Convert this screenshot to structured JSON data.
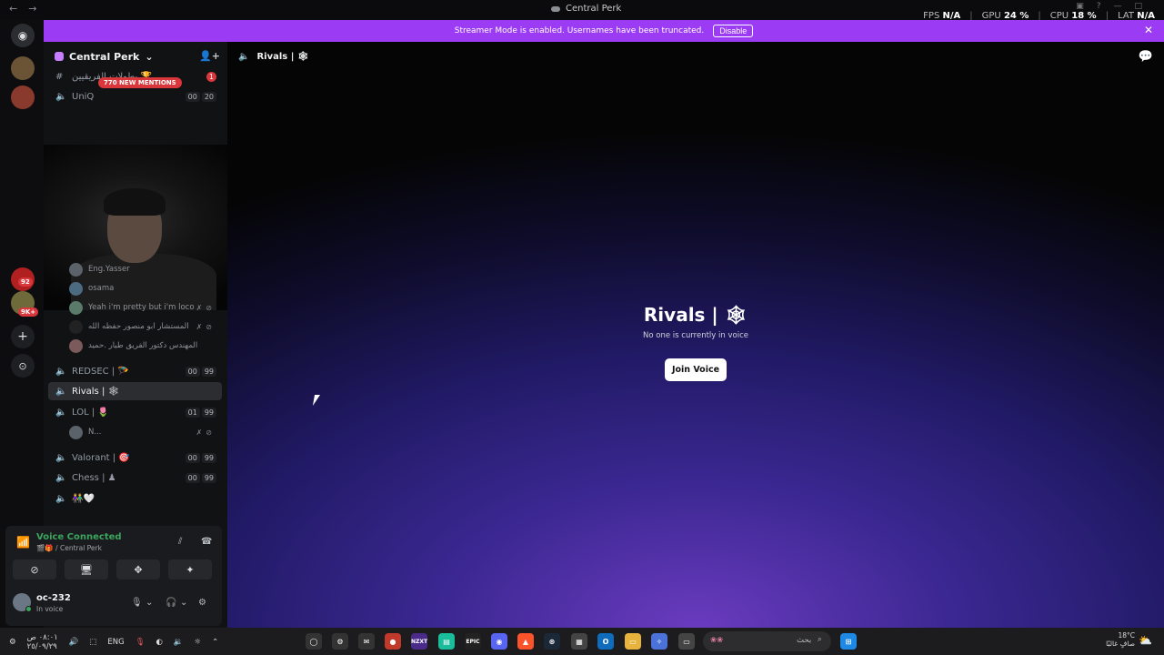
{
  "titlebar": {
    "title": "Central Perk"
  },
  "stats": {
    "fps_label": "FPS",
    "fps_value": "N/A",
    "gpu_label": "GPU",
    "gpu_value": "24 %",
    "cpu_label": "CPU",
    "cpu_value": "18 %",
    "lat_label": "LAT",
    "lat_value": "N/A"
  },
  "banner": {
    "text": "Streamer Mode is enabled. Usernames have been truncated.",
    "disable_label": "Disable"
  },
  "rail": {
    "badges": [
      "92",
      "9K+"
    ]
  },
  "server": {
    "name": "Central Perk"
  },
  "mentions_label": "770 NEW MENTIONS",
  "channels": [
    {
      "name": "UniQ",
      "counts": [
        "00",
        "20"
      ]
    },
    {
      "name": "REDSEC | 🪂",
      "counts": [
        "00",
        "99"
      ]
    },
    {
      "name": "Rivals | 🕸",
      "counts": []
    },
    {
      "name": "LOL | 🌷",
      "counts": [
        "01",
        "99"
      ]
    },
    {
      "name": "Valorant | 🎯",
      "counts": [
        "00",
        "99"
      ]
    },
    {
      "name": "Chess | ♟",
      "counts": [
        "00",
        "99"
      ]
    },
    {
      "name": "👫🤍",
      "counts": []
    }
  ],
  "top_channel": {
    "name": "بطولات الفريقيين 🏆",
    "badge": "1"
  },
  "users": [
    {
      "name": "Eng.Yasser"
    },
    {
      "name": "osama"
    },
    {
      "name": "Yeah i'm pretty but i'm loco"
    },
    {
      "name": "المستشار ابو منصور حفظه الله"
    },
    {
      "name": "المهندس دكتور الفريق طيار .حميد"
    },
    {
      "name": "N..."
    }
  ],
  "voice": {
    "status": "Voice Connected",
    "location": "🎬🎁 / Central Perk",
    "username": "oc-232",
    "user_status": "In voice"
  },
  "main": {
    "header": "Rivals | 🕸",
    "title": "Rivals | 🕸",
    "subtitle": "No one is currently in voice",
    "join_label": "Join Voice"
  },
  "taskbar": {
    "time": "٠٨:٠١ ص",
    "date": "٢٥/٠٩/٢٩",
    "lang": "ENG",
    "search_placeholder": "بحث",
    "temp": "18°C",
    "weather": "صافٍ غالبًا",
    "apps": [
      "NZXT",
      "EPIC"
    ]
  },
  "colors": {
    "accent": "#9b3bf3",
    "voice_green": "#3ba55d",
    "badge_red": "#da373c"
  }
}
